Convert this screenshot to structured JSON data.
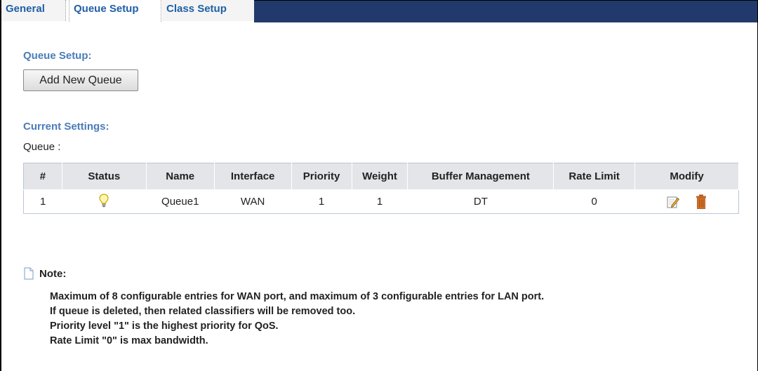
{
  "tabs": [
    {
      "label": "General"
    },
    {
      "label": "Queue Setup"
    },
    {
      "label": "Class Setup"
    }
  ],
  "queue_setup": {
    "title": "Queue Setup:",
    "add_button": "Add New Queue"
  },
  "current_settings": {
    "title": "Current Settings:",
    "queue_label": "Queue :"
  },
  "table": {
    "headers": [
      "#",
      "Status",
      "Name",
      "Interface",
      "Priority",
      "Weight",
      "Buffer Management",
      "Rate Limit",
      "Modify"
    ],
    "rows": [
      {
        "index": "1",
        "status_icon": "lightbulb-icon",
        "name": "Queue1",
        "interface": "WAN",
        "priority": "1",
        "weight": "1",
        "buffer": "DT",
        "rate_limit": "0"
      }
    ]
  },
  "note": {
    "label": "Note:",
    "lines": [
      "Maximum of 8 configurable entries for WAN port, and maximum of 3 configurable entries for LAN port.",
      "If queue is deleted, then related classifiers will be removed too.",
      "Priority level \"1\" is the highest priority for QoS.",
      "Rate Limit \"0\" is max bandwidth."
    ]
  },
  "colors": {
    "tab_text": "#1f5fa5",
    "tab_bar_fill": "#213a6b",
    "section_title": "#4a7cb8",
    "header_bg": "#e3e5e8"
  }
}
